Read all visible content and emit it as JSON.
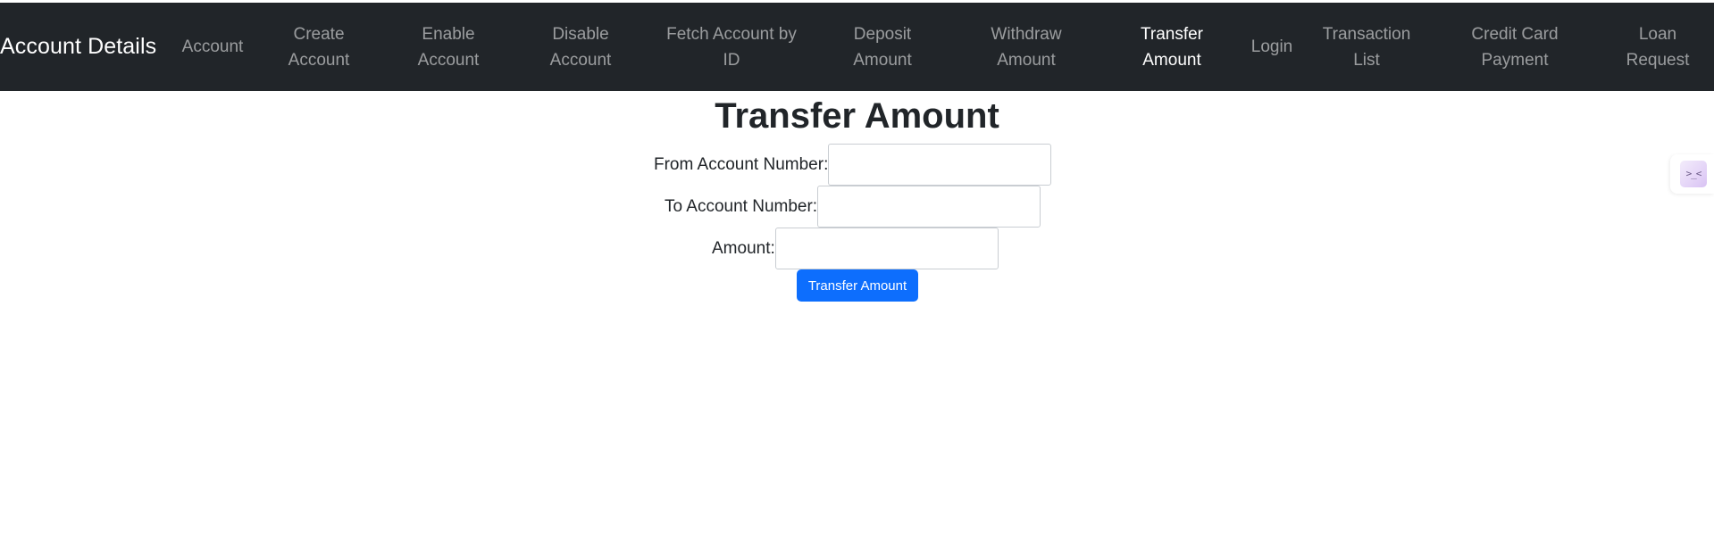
{
  "navbar": {
    "brand": "Account Details",
    "items": [
      {
        "lines": [
          "Account"
        ],
        "active": false
      },
      {
        "lines": [
          "Create",
          "Account"
        ],
        "active": false
      },
      {
        "lines": [
          "Enable",
          "Account"
        ],
        "active": false
      },
      {
        "lines": [
          "Disable",
          "Account"
        ],
        "active": false
      },
      {
        "lines": [
          "Fetch Account by",
          "ID"
        ],
        "active": false
      },
      {
        "lines": [
          "Deposit",
          "Amount"
        ],
        "active": false
      },
      {
        "lines": [
          "Withdraw",
          "Amount"
        ],
        "active": false
      },
      {
        "lines": [
          "Transfer",
          "Amount"
        ],
        "active": true
      },
      {
        "lines": [
          "Login"
        ],
        "active": false
      },
      {
        "lines": [
          "Transaction",
          "List"
        ],
        "active": false
      },
      {
        "lines": [
          "Credit Card",
          "Payment"
        ],
        "active": false
      },
      {
        "lines": [
          "Loan",
          "Request"
        ],
        "active": false
      }
    ]
  },
  "main": {
    "title": "Transfer Amount",
    "form": {
      "from_label": "From Account Number:",
      "from_value": "",
      "to_label": "To Account Number:",
      "to_value": "",
      "amount_label": "Amount:",
      "amount_value": "",
      "submit_label": "Transfer Amount"
    }
  },
  "extension": {
    "icon": "extension-face-icon",
    "glyph": ">_<"
  },
  "colors": {
    "navbar_bg": "#212529",
    "nav_text": "rgba(255,255,255,0.55)",
    "nav_active": "#ffffff",
    "primary_button": "#0d6efd"
  }
}
